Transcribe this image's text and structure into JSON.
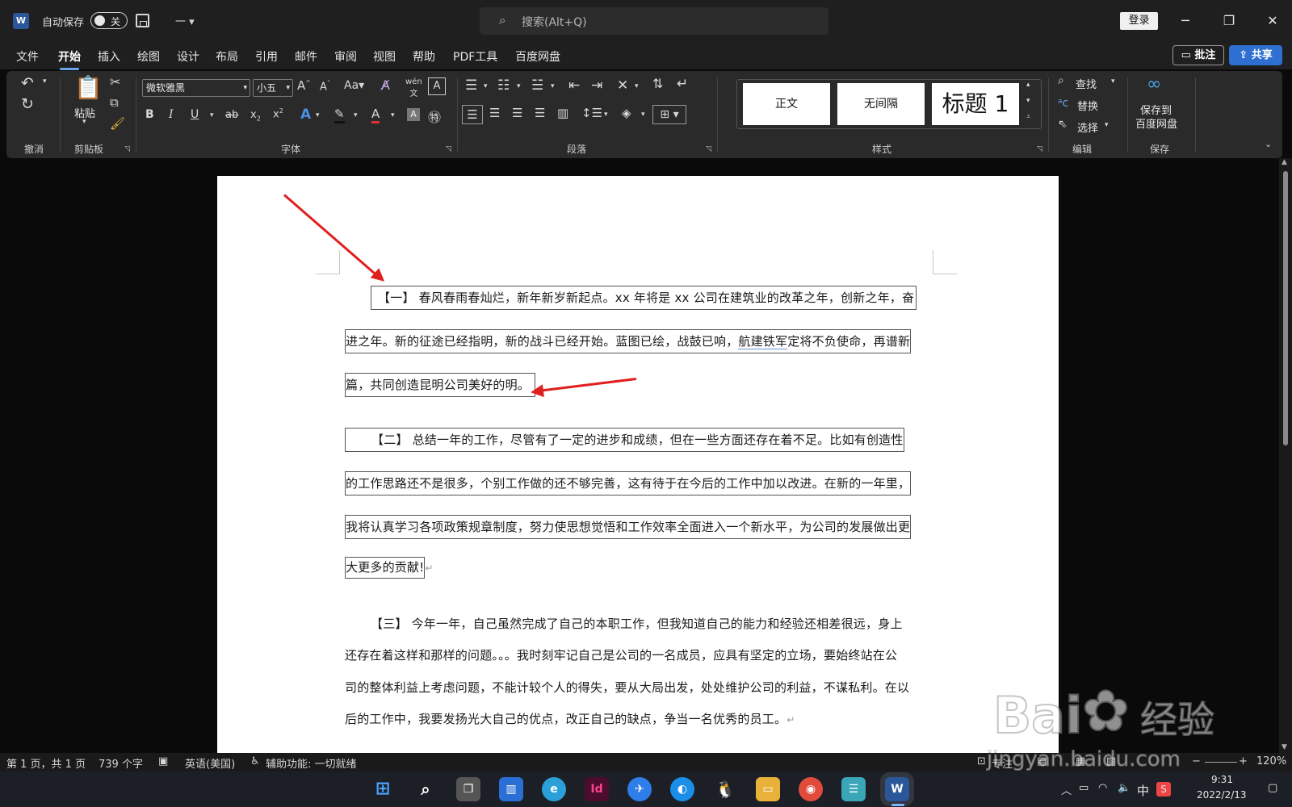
{
  "titlebar": {
    "app_logo": "W",
    "autosave_label": "自动保存",
    "autosave_state": "关",
    "qat_more": "一 ▾",
    "search_placeholder": "搜索(Alt+Q)",
    "login": "登录"
  },
  "menu": {
    "tabs": [
      "文件",
      "开始",
      "插入",
      "绘图",
      "设计",
      "布局",
      "引用",
      "邮件",
      "审阅",
      "视图",
      "帮助",
      "PDF工具",
      "百度网盘"
    ],
    "active": "开始",
    "comment_btn": "批注",
    "share_btn": "共享"
  },
  "ribbon": {
    "groups": {
      "undo": "撤消",
      "clipboard": "剪贴板",
      "font": "字体",
      "paragraph": "段落",
      "styles": "样式",
      "editing": "编辑",
      "save": "保存"
    },
    "paste_label": "粘贴",
    "font_name": "微软雅黑",
    "font_size": "小五",
    "styles": [
      "正文",
      "无间隔",
      "标题 1"
    ],
    "editing": {
      "find": "查找",
      "replace": "替换",
      "select": "选择"
    },
    "save_baidu": [
      "保存到",
      "百度网盘"
    ]
  },
  "document": {
    "p1": {
      "line1": "【一】 春风春雨春灿烂，新年新岁新起点。xx 年将是 xx 公司在建筑业的改革之年，创新之年，奋",
      "line2_a": "进之年。新的征途已经指明，新的战斗已经开始。蓝图已绘，战鼓已响，",
      "line2_ul": "航建铁军",
      "line2_b": "定将不负使命，再谱新",
      "line3": "篇，共同创造昆明公司美好的明。"
    },
    "p2": {
      "line1": "【二】 总结一年的工作，尽管有了一定的进步和成绩，但在一些方面还存在着不足。比如有创造性",
      "line2": "的工作思路还不是很多，个别工作做的还不够完善，这有待于在今后的工作中加以改进。在新的一年里，",
      "line3": "我将认真学习各项政策规章制度，努力使思想觉悟和工作效率全面进入一个新水平，为公司的发展做出更",
      "line4": "大更多的贡献!"
    },
    "p3": {
      "line1": "【三】 今年一年，自己虽然完成了自己的本职工作，但我知道自己的能力和经验还相差很远，身上",
      "line2": "还存在着这样和那样的问题。。。我时刻牢记自己是公司的一名成员，应具有坚定的立场，要始终站在公",
      "line3": "司的整体利益上考虑问题，不能计较个人的得失，要从大局出发，处处维护公司的利益，不谋私利。在以",
      "line4": "后的工作中，我要发扬光大自己的优点，改正自己的缺点，争当一名优秀的员工。"
    },
    "para_mark": "↵"
  },
  "statusbar": {
    "page": "第 1 页，共 1 页",
    "words": "739 个字",
    "language": "英语(美国)",
    "accessibility": "辅助功能: 一切就绪",
    "focus": "专注",
    "zoom": "120%"
  },
  "taskbar": {
    "apps": [
      "start",
      "search",
      "task-view",
      "widgets",
      "edge",
      "indesign",
      "feishu",
      "browser",
      "qq",
      "explorer",
      "chrome",
      "notepad",
      "word"
    ],
    "tray_ime": "中",
    "time": "9:31",
    "date": "2022/2/13"
  },
  "watermark": {
    "brand": "Bai",
    "brand_cn": "经验",
    "url": "jingyan.baidu.com"
  },
  "colors": {
    "accent": "#2e6fd1",
    "arrow": "#e01f1f",
    "ribbon": "#2a2a2a",
    "page": "#ffffff"
  }
}
